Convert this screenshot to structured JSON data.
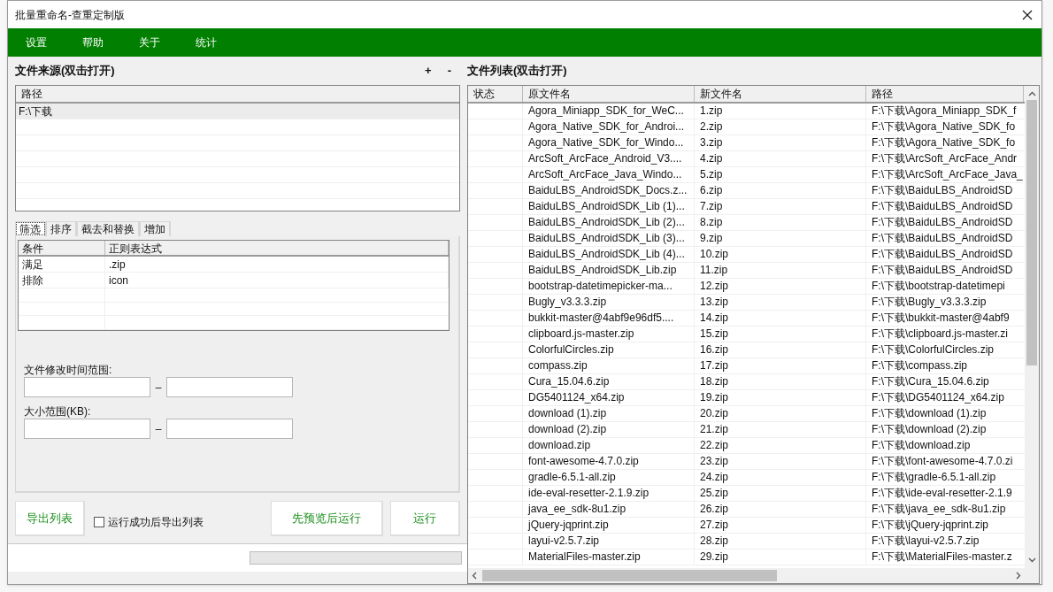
{
  "window": {
    "title": "批量重命名-查重定制版"
  },
  "menu": [
    "设置",
    "帮助",
    "关于",
    "统计"
  ],
  "source": {
    "title": "文件来源(双击打开)",
    "add": "+",
    "remove": "-",
    "column": "路径",
    "rows": [
      {
        "path": "F:\\下载",
        "selected": true
      }
    ]
  },
  "tabs": [
    {
      "label": "筛选",
      "selected": true
    },
    {
      "label": "排序",
      "selected": false
    },
    {
      "label": "截去和替换",
      "selected": false
    },
    {
      "label": "增加",
      "selected": false
    }
  ],
  "filter": {
    "columns": [
      "条件",
      "正则表达式"
    ],
    "rows": [
      [
        "满足",
        ".zip"
      ],
      [
        "排除",
        "icon"
      ]
    ]
  },
  "time_range": {
    "label": "文件修改时间范围:",
    "separator": "–"
  },
  "size_range": {
    "label": "大小范围(KB):",
    "separator": "–"
  },
  "actions": {
    "export": "导出列表",
    "export_after": {
      "label": "运行成功后导出列表",
      "checked": false
    },
    "preview": "先预览后运行",
    "run": "运行"
  },
  "status_bar": {
    "progress": {
      "level": 0
    }
  },
  "files": {
    "title": "文件列表(双击打开)",
    "columns": [
      "状态",
      "原文件名",
      "新文件名",
      "路径"
    ],
    "rows": [
      {
        "original": "Agora_Miniapp_SDK_for_WeC...",
        "new": "1.zip",
        "path": "F:\\下载\\Agora_Miniapp_SDK_f"
      },
      {
        "original": "Agora_Native_SDK_for_Androi...",
        "new": "2.zip",
        "path": "F:\\下载\\Agora_Native_SDK_fo"
      },
      {
        "original": "Agora_Native_SDK_for_Windo...",
        "new": "3.zip",
        "path": "F:\\下载\\Agora_Native_SDK_fo"
      },
      {
        "original": "ArcSoft_ArcFace_Android_V3....",
        "new": "4.zip",
        "path": "F:\\下载\\ArcSoft_ArcFace_Andr"
      },
      {
        "original": "ArcSoft_ArcFace_Java_Windo...",
        "new": "5.zip",
        "path": "F:\\下载\\ArcSoft_ArcFace_Java_"
      },
      {
        "original": "BaiduLBS_AndroidSDK_Docs.z...",
        "new": "6.zip",
        "path": "F:\\下载\\BaiduLBS_AndroidSD"
      },
      {
        "original": "BaiduLBS_AndroidSDK_Lib (1)...",
        "new": "7.zip",
        "path": "F:\\下载\\BaiduLBS_AndroidSD"
      },
      {
        "original": "BaiduLBS_AndroidSDK_Lib (2)...",
        "new": "8.zip",
        "path": "F:\\下载\\BaiduLBS_AndroidSD"
      },
      {
        "original": "BaiduLBS_AndroidSDK_Lib (3)...",
        "new": "9.zip",
        "path": "F:\\下载\\BaiduLBS_AndroidSD"
      },
      {
        "original": "BaiduLBS_AndroidSDK_Lib (4)...",
        "new": "10.zip",
        "path": "F:\\下载\\BaiduLBS_AndroidSD"
      },
      {
        "original": "BaiduLBS_AndroidSDK_Lib.zip",
        "new": "11.zip",
        "path": "F:\\下载\\BaiduLBS_AndroidSD"
      },
      {
        "original": "bootstrap-datetimepicker-ma...",
        "new": "12.zip",
        "path": "F:\\下载\\bootstrap-datetimepi"
      },
      {
        "original": "Bugly_v3.3.3.zip",
        "new": "13.zip",
        "path": "F:\\下载\\Bugly_v3.3.3.zip"
      },
      {
        "original": "bukkit-master@4abf9e96df5....",
        "new": "14.zip",
        "path": "F:\\下载\\bukkit-master@4abf9"
      },
      {
        "original": "clipboard.js-master.zip",
        "new": "15.zip",
        "path": "F:\\下载\\clipboard.js-master.zi"
      },
      {
        "original": "ColorfulCircles.zip",
        "new": "16.zip",
        "path": "F:\\下载\\ColorfulCircles.zip"
      },
      {
        "original": "compass.zip",
        "new": "17.zip",
        "path": "F:\\下载\\compass.zip"
      },
      {
        "original": "Cura_15.04.6.zip",
        "new": "18.zip",
        "path": "F:\\下载\\Cura_15.04.6.zip"
      },
      {
        "original": "DG5401124_x64.zip",
        "new": "19.zip",
        "path": "F:\\下载\\DG5401124_x64.zip"
      },
      {
        "original": "download (1).zip",
        "new": "20.zip",
        "path": "F:\\下载\\download (1).zip"
      },
      {
        "original": "download (2).zip",
        "new": "21.zip",
        "path": "F:\\下载\\download (2).zip"
      },
      {
        "original": "download.zip",
        "new": "22.zip",
        "path": "F:\\下载\\download.zip"
      },
      {
        "original": "font-awesome-4.7.0.zip",
        "new": "23.zip",
        "path": "F:\\下载\\font-awesome-4.7.0.zi"
      },
      {
        "original": "gradle-6.5.1-all.zip",
        "new": "24.zip",
        "path": "F:\\下载\\gradle-6.5.1-all.zip"
      },
      {
        "original": "ide-eval-resetter-2.1.9.zip",
        "new": "25.zip",
        "path": "F:\\下载\\ide-eval-resetter-2.1.9"
      },
      {
        "original": "java_ee_sdk-8u1.zip",
        "new": "26.zip",
        "path": "F:\\下载\\java_ee_sdk-8u1.zip"
      },
      {
        "original": "jQuery-jqprint.zip",
        "new": "27.zip",
        "path": "F:\\下载\\jQuery-jqprint.zip"
      },
      {
        "original": "layui-v2.5.7.zip",
        "new": "28.zip",
        "path": "F:\\下载\\layui-v2.5.7.zip"
      },
      {
        "original": "MaterialFiles-master.zip",
        "new": "29.zip",
        "path": "F:\\下载\\MaterialFiles-master.z"
      }
    ]
  }
}
